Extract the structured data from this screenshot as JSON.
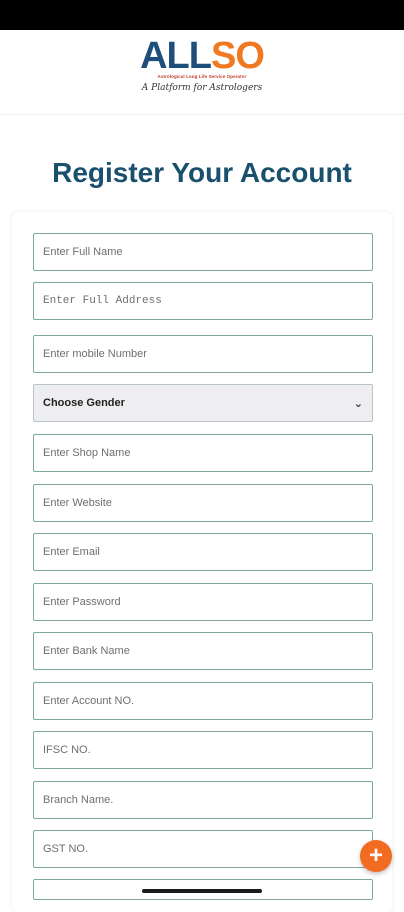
{
  "logo": {
    "part1": "ALL",
    "part2": "SO",
    "subtitle": "Astrological Long Life Service Operator",
    "tagline": "A Platform for Astrologers"
  },
  "page": {
    "title": "Register Your Account"
  },
  "form": {
    "full_name": {
      "placeholder": "Enter Full Name"
    },
    "full_address": {
      "placeholder": "Enter Full Address"
    },
    "mobile": {
      "placeholder": "Enter mobile Number"
    },
    "gender": {
      "selected": "Choose Gender"
    },
    "shop_name": {
      "placeholder": "Enter Shop Name"
    },
    "website": {
      "placeholder": "Enter Website"
    },
    "email": {
      "placeholder": "Enter Email"
    },
    "password": {
      "placeholder": "Enter Password"
    },
    "bank_name": {
      "placeholder": "Enter Bank Name"
    },
    "account_no": {
      "placeholder": "Enter Account NO."
    },
    "ifsc": {
      "placeholder": "IFSC NO."
    },
    "branch": {
      "placeholder": "Branch Name."
    },
    "gst": {
      "placeholder": "GST NO."
    }
  },
  "fab": {
    "icon": "plus-icon",
    "label": "+"
  },
  "colors": {
    "brand_blue": "#1d4f7a",
    "brand_orange": "#f07a22",
    "title": "#18506d",
    "field_border": "#7ea7a3",
    "fab": "#f36a21"
  }
}
